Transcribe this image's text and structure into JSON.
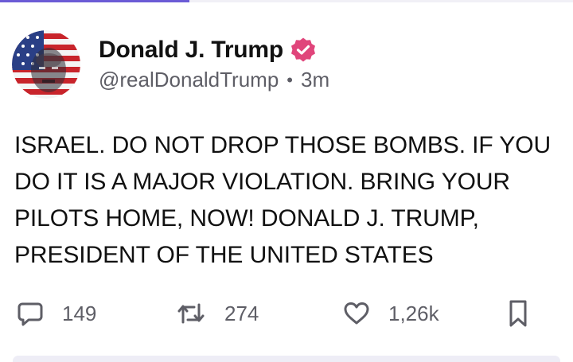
{
  "post": {
    "author": {
      "display_name": "Donald J. Trump",
      "handle": "@realDonaldTrump",
      "verified": true,
      "avatar": "flag-portrait-avatar"
    },
    "time_ago": "3m",
    "separator": "•",
    "text": "ISRAEL. DO NOT DROP THOSE BOMBS. IF YOU DO IT IS A MAJOR VIOLATION. BRING YOUR PILOTS HOME, NOW! DONALD J. TRUMP, PRESIDENT OF THE UNITED STATES"
  },
  "actions": {
    "replies": "149",
    "reposts": "274",
    "likes": "1,26k"
  },
  "colors": {
    "verified_badge": "#e0457b",
    "accent": "#6b5bd6",
    "muted_text": "#5e5e66"
  },
  "icons": {
    "reply": "speech-bubble-icon",
    "repost": "repost-arrows-icon",
    "like": "heart-icon",
    "bookmark": "bookmark-icon",
    "verified": "verified-badge-icon"
  }
}
